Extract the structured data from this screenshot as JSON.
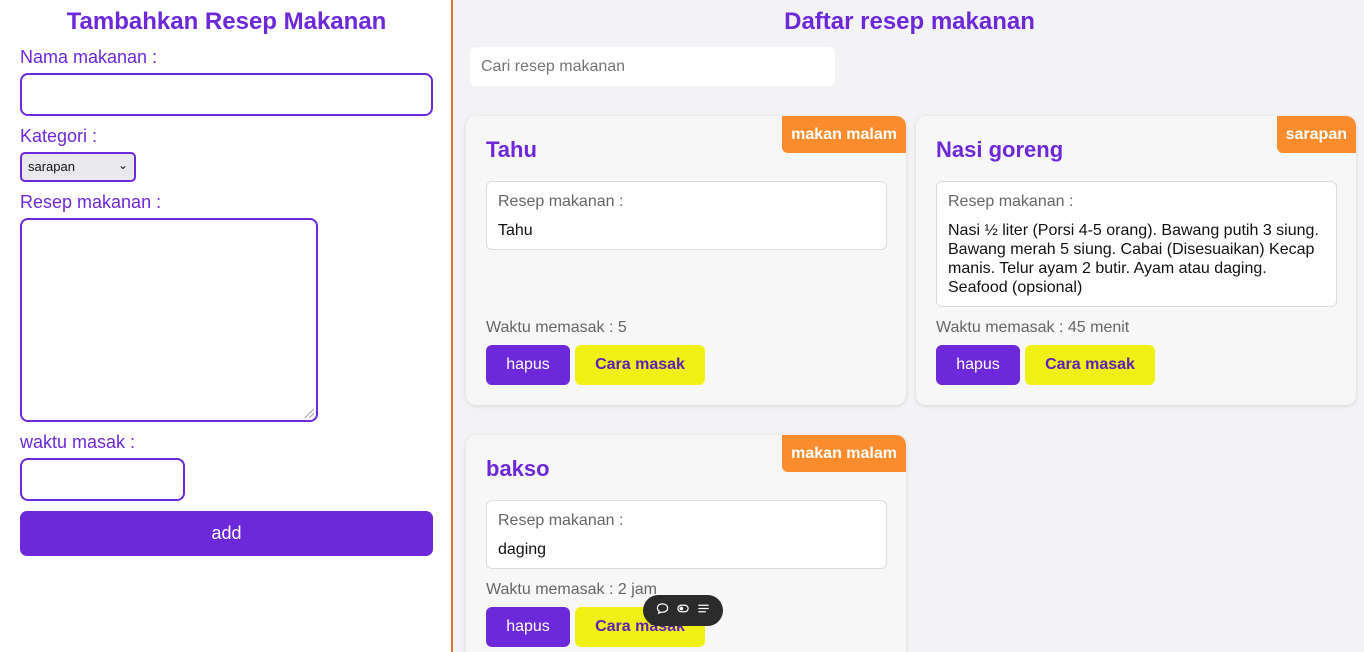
{
  "form": {
    "title": "Tambahkan Resep Makanan",
    "name_label": "Nama makanan :",
    "name_value": "",
    "category_label": "Kategori :",
    "category_value": "sarapan",
    "recipe_label": "Resep makanan :",
    "recipe_value": "",
    "time_label": "waktu masak :",
    "time_value": "",
    "add_label": "add"
  },
  "list": {
    "title": "Daftar resep makanan",
    "search_placeholder": "Cari resep makanan",
    "cards": [
      {
        "name": "Tahu",
        "badge": "makan malam",
        "recipe_label": "Resep makanan :",
        "recipe": "Tahu",
        "time": "Waktu memasak : 5",
        "delete_label": "hapus",
        "cook_label": "Cara masak"
      },
      {
        "name": "Nasi goreng",
        "badge": "sarapan",
        "recipe_label": "Resep makanan :",
        "recipe": "Nasi ½ liter (Porsi 4-5 orang). Bawang putih 3 siung. Bawang merah 5 siung. Cabai (Disesuaikan) Kecap manis. Telur ayam 2 butir. Ayam atau daging. Seafood (opsional)",
        "time": "Waktu memasak : 45 menit",
        "delete_label": "hapus",
        "cook_label": "Cara masak"
      },
      {
        "name": "bakso",
        "badge": "makan malam",
        "recipe_label": "Resep makanan :",
        "recipe": "daging",
        "time": "Waktu memasak : 2 jam",
        "delete_label": "hapus",
        "cook_label": "Cara masak"
      }
    ]
  },
  "toolbar": {
    "icons": [
      "chat-icon",
      "toggle-icon",
      "list-icon"
    ]
  },
  "colors": {
    "accent": "#6d28d9",
    "badge": "#fb8c2e",
    "cook_button": "#f0f014",
    "divider": "#e0742b"
  }
}
